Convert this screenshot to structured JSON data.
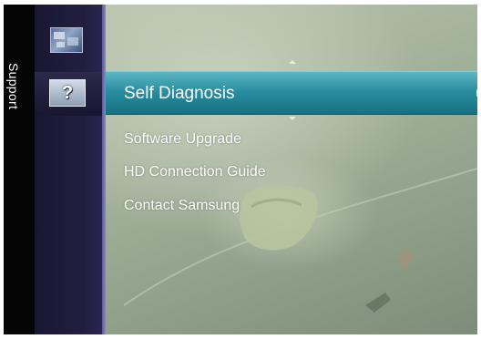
{
  "sidebar": {
    "category_label": "Support",
    "icons": [
      {
        "name": "picture-icon",
        "active": false
      },
      {
        "name": "question-mark-icon",
        "glyph": "?",
        "active": true
      }
    ]
  },
  "menu": {
    "selected": "Self Diagnosis",
    "items": [
      "Self Diagnosis",
      "Software Upgrade",
      "HD Connection Guide",
      "Contact Samsung"
    ]
  },
  "colors": {
    "highlight": "#2a8ea1",
    "sidebar": "#221e40",
    "divider": "#7a78b8"
  }
}
